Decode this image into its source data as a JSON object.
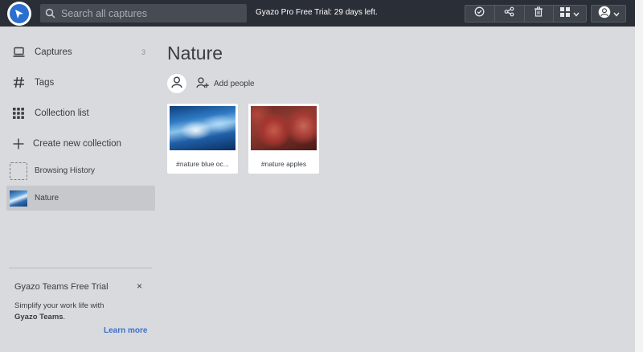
{
  "header": {
    "search_placeholder": "Search all captures",
    "trial_text": "Gyazo Pro Free Trial: 29 days left.",
    "toolbar_icons": [
      "check-circle-icon",
      "share-icon",
      "trash-icon",
      "grid-view-icon",
      "account-icon"
    ]
  },
  "sidebar": {
    "items": [
      {
        "label": "Captures",
        "count": "3",
        "icon": "laptop-icon"
      },
      {
        "label": "Tags",
        "icon": "hash-icon"
      },
      {
        "label": "Collection list",
        "icon": "grid-dots-icon"
      },
      {
        "label": "Create new collection",
        "icon": "plus-icon"
      },
      {
        "label": "Browsing History",
        "icon": "dashed-square-icon"
      },
      {
        "label": "Nature",
        "icon": "nature-thumbnail",
        "active": true
      }
    ],
    "promo": {
      "title": "Gyazo Teams Free Trial",
      "close": "×",
      "body_prefix": "Simplify your work life with",
      "body_bold": "Gyazo Teams",
      "body_suffix": ".",
      "link": "Learn more"
    }
  },
  "main": {
    "title": "Nature",
    "add_people_label": "Add people",
    "cards": [
      {
        "caption": "#nature blue oc..."
      },
      {
        "caption": "#nature apples"
      }
    ]
  },
  "colors": {
    "topbar": "#2a2e36",
    "background": "#d9dadd",
    "accent_link": "#3b70c9",
    "logo_blue": "#2b6fcf"
  }
}
